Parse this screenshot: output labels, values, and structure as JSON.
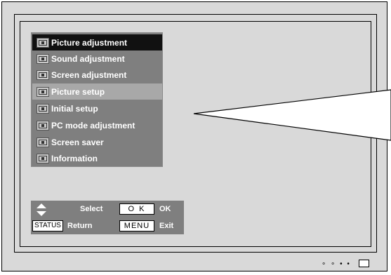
{
  "menu": {
    "items": [
      {
        "label": "Picture adjustment",
        "icon": "picture-adjustment-icon",
        "state": "selected"
      },
      {
        "label": "Sound adjustment",
        "icon": "sound-adjustment-icon",
        "state": "normal"
      },
      {
        "label": "Screen adjustment",
        "icon": "screen-adjustment-icon",
        "state": "normal"
      },
      {
        "label": "Picture setup",
        "icon": "picture-setup-icon",
        "state": "highlight"
      },
      {
        "label": "Initial setup",
        "icon": "initial-setup-icon",
        "state": "normal"
      },
      {
        "label": "PC mode adjustment",
        "icon": "pc-mode-icon",
        "state": "normal"
      },
      {
        "label": "Screen saver",
        "icon": "screen-saver-icon",
        "state": "normal"
      },
      {
        "label": "Information",
        "icon": "information-icon",
        "state": "normal"
      }
    ]
  },
  "guide": {
    "select_label": "Select",
    "ok_key": "O K",
    "ok_label": "OK",
    "status_key": "STATUS",
    "return_label": "Return",
    "menu_key": "MENU",
    "exit_label": "Exit"
  },
  "colors": {
    "menu_bg": "#7f7f7f",
    "selected_bg": "#111111",
    "highlight_bg": "#a8a8a8",
    "screen_bg": "#d9d9d9"
  }
}
